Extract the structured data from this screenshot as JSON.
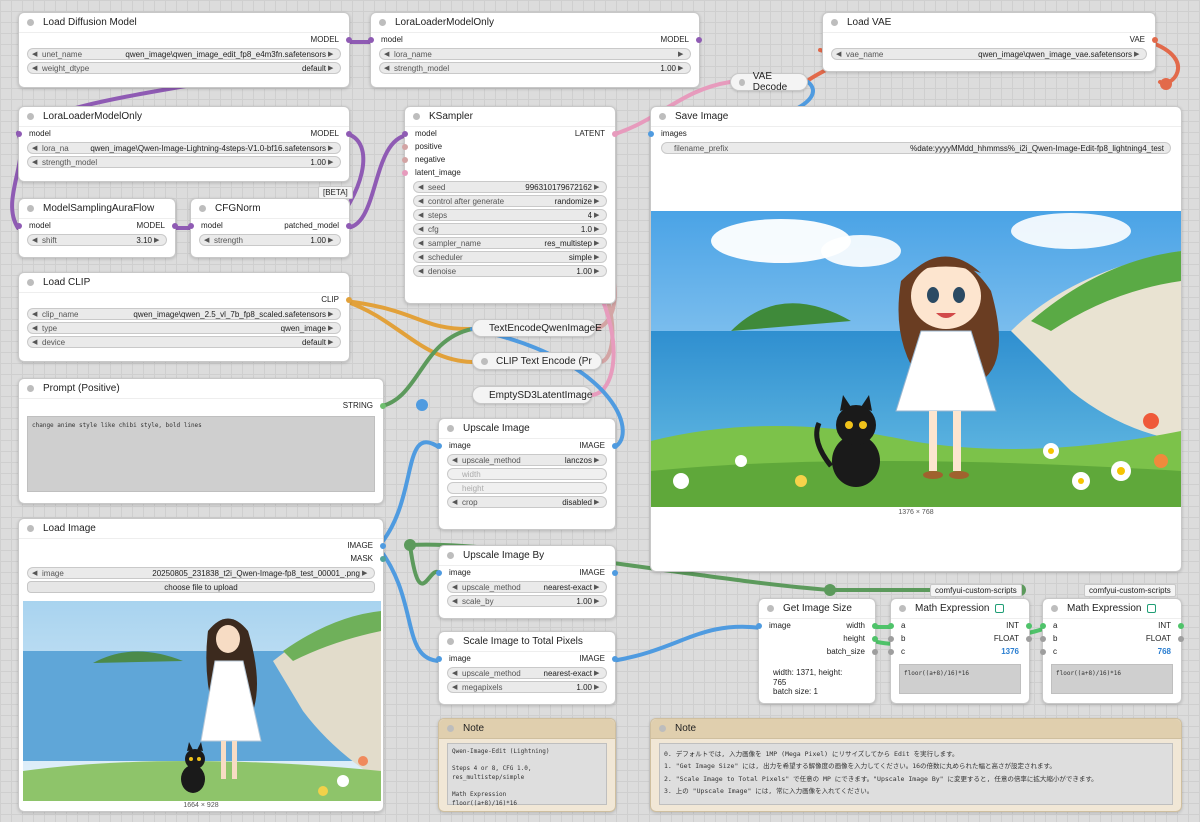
{
  "colors": {
    "model": "#8f5bb4",
    "clip": "#e2a13a",
    "vae": "#e26a4b",
    "image": "#4f9be0",
    "conditioning": "#d3a4a4",
    "latent": "#e79bbd",
    "string": "#6fbf6f",
    "int": "#4fc36a"
  },
  "load_diffusion": {
    "title": "Load Diffusion Model",
    "out": "MODEL",
    "w1_label": "unet_name",
    "w1_value": "qwen_image\\qwen_image_edit_fp8_e4m3fn.safetensors",
    "w2_label": "weight_dtype",
    "w2_value": "default"
  },
  "lora1": {
    "title": "LoraLoaderModelOnly",
    "in": "model",
    "out": "MODEL",
    "w1_label": "lora_name",
    "w1_value": "",
    "w2_label": "strength_model",
    "w2_value": "1.00"
  },
  "load_vae": {
    "title": "Load VAE",
    "out": "VAE",
    "w1_label": "vae_name",
    "w1_value": "qwen_image\\qwen_image_vae.safetensors"
  },
  "vae_decode": {
    "title": "VAE Decode"
  },
  "lora2": {
    "title": "LoraLoaderModelOnly",
    "in": "model",
    "out": "MODEL",
    "w1_label": "lora_na",
    "w1_value": "qwen_image\\Qwen-Image-Lightning-4steps-V1.0-bf16.safetensors",
    "w2_label": "strength_model",
    "w2_value": "1.00"
  },
  "beta_tag": "[BETA]",
  "ksampler": {
    "title": "KSampler",
    "inputs": [
      "model",
      "positive",
      "negative",
      "latent_image"
    ],
    "out": "LATENT",
    "widgets": [
      {
        "label": "seed",
        "value": "996310179672162"
      },
      {
        "label": "control after generate",
        "value": "randomize"
      },
      {
        "label": "steps",
        "value": "4"
      },
      {
        "label": "cfg",
        "value": "1.0"
      },
      {
        "label": "sampler_name",
        "value": "res_multistep"
      },
      {
        "label": "scheduler",
        "value": "simple"
      },
      {
        "label": "denoise",
        "value": "1.00"
      }
    ]
  },
  "save_image": {
    "title": "Save Image",
    "in": "images",
    "w1_label": "filename_prefix",
    "w1_value": "%date:yyyyMMdd_hhmmss%_i2i_Qwen-Image-Edit-fp8_lightning4_test",
    "size_caption": "1376 × 768"
  },
  "model_sampling": {
    "title": "ModelSamplingAuraFlow",
    "in": "model",
    "out": "MODEL",
    "w1_label": "shift",
    "w1_value": "3.10"
  },
  "cfgnorm": {
    "title": "CFGNorm",
    "in": "model",
    "out": "patched_model",
    "w1_label": "strength",
    "w1_value": "1.00"
  },
  "load_clip": {
    "title": "Load CLIP",
    "out": "CLIP",
    "widgets": [
      {
        "label": "clip_name",
        "value": "qwen_image\\qwen_2.5_vl_7b_fp8_scaled.safetensors"
      },
      {
        "label": "type",
        "value": "qwen_image"
      },
      {
        "label": "device",
        "value": "default"
      }
    ]
  },
  "text_encode_qwen": {
    "title": "TextEncodeQwenImageE"
  },
  "clip_text_encode": {
    "title": "CLIP Text Encode (Pr"
  },
  "empty_latent": {
    "title": "EmptySD3LatentImage"
  },
  "prompt": {
    "title": "Prompt (Positive)",
    "out": "STRING",
    "text": "change anime style like chibi style, bold lines"
  },
  "upscale_image": {
    "title": "Upscale Image",
    "in": "image",
    "out": "IMAGE",
    "widgets": [
      {
        "label": "upscale_method",
        "value": "lanczos",
        "dim": false
      },
      {
        "label": "width",
        "value": "",
        "dim": true
      },
      {
        "label": "height",
        "value": "",
        "dim": true
      },
      {
        "label": "crop",
        "value": "disabled",
        "dim": false
      }
    ]
  },
  "load_image": {
    "title": "Load Image",
    "out1": "IMAGE",
    "out2": "MASK",
    "w1_label": "image",
    "w1_value": "20250805_231838_t2i_Qwen-Image-fp8_test_00001_.png",
    "button": "choose file to upload",
    "size_caption": "1664 × 928"
  },
  "upscale_by": {
    "title": "Upscale Image By",
    "in": "image",
    "out": "IMAGE",
    "w1_label": "upscale_method",
    "w1_value": "nearest-exact",
    "w2_label": "scale_by",
    "w2_value": "1.00"
  },
  "scale_total": {
    "title": "Scale Image to Total Pixels",
    "in": "image",
    "out": "IMAGE",
    "w1_label": "upscale_method",
    "w1_value": "nearest-exact",
    "w2_label": "megapixels",
    "w2_value": "1.00"
  },
  "get_size": {
    "title": "Get Image Size",
    "in": "image",
    "outs": [
      "width",
      "height",
      "batch_size"
    ],
    "info": "width: 1371, height:\n765\nbatch size: 1"
  },
  "math1": {
    "tag": "comfyui-custom-scripts",
    "title": "Math Expression",
    "ins": [
      "a",
      "b",
      "c"
    ],
    "out1": "INT",
    "out2": "FLOAT",
    "result": "1376",
    "expr": "floor((a+8)/16)*16"
  },
  "math2": {
    "tag": "comfyui-custom-scripts",
    "title": "Math Expression",
    "ins": [
      "a",
      "b",
      "c"
    ],
    "out1": "INT",
    "out2": "FLOAT",
    "result": "768",
    "expr": "floor((a+8)/16)*16"
  },
  "note1": {
    "title": "Note",
    "text": "Qwen-Image-Edit (Lightning)\n\nSteps 4 or 8, CFG 1.0, res_multistep/simple\n\nMath Expression\nfloor((a+8)/16)*16"
  },
  "note2": {
    "title": "Note",
    "text": "0. デフォルトでは, 入力画像を 1MP (Mega Pixel) にリサイズしてから Edit を実行します。\n1. \"Get Image Size\" には, 出力を希望する解像度の画像を入力してください。16の倍数に丸められた幅と高さが設定されます。\n2. \"Scale Image to Total Pixels\" で任意の MP にできます。\"Upscale Image By\" に変更すると, 任意の倍率に拡大縮小ができます。\n3. 上の \"Upscale Image\" には, 常に入力画像を入れてください。"
  }
}
